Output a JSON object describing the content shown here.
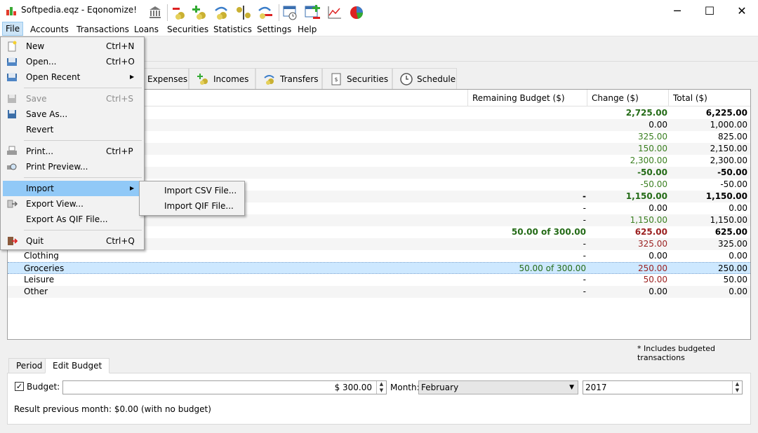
{
  "window": {
    "title": "Softpedia.eqz - Eqonomize!",
    "minimize": "─",
    "maximize": "☐",
    "close": "✕"
  },
  "menubar": {
    "items": [
      "File",
      "Accounts",
      "Transactions",
      "Loans",
      "Securities",
      "Statistics",
      "Settings",
      "Help"
    ]
  },
  "tabs": {
    "expenses": "Expenses",
    "incomes": "Incomes",
    "transfers": "Transfers",
    "securities": "Securities",
    "schedule": "Schedule"
  },
  "table": {
    "headers": {
      "remaining": "Remaining Budget ($)",
      "change": "Change ($)",
      "total": "Total ($)"
    },
    "rows": [
      {
        "name": "",
        "remaining": "",
        "change": "2,725.00",
        "total": "6,225.00",
        "style": "bold-green"
      },
      {
        "name": "",
        "remaining": "",
        "change": "0.00",
        "total": "1,000.00",
        "style": "plain"
      },
      {
        "name": "",
        "remaining": "",
        "change": "325.00",
        "total": "825.00",
        "style": "green"
      },
      {
        "name": "",
        "remaining": "",
        "change": "150.00",
        "total": "2,150.00",
        "style": "green"
      },
      {
        "name": "",
        "remaining": "",
        "change": "2,300.00",
        "total": "2,300.00",
        "style": "green"
      },
      {
        "name": "",
        "remaining": "",
        "change": "-50.00",
        "total": "-50.00",
        "style": "bold-green"
      },
      {
        "name": "",
        "remaining": "",
        "change": "-50.00",
        "total": "-50.00",
        "style": "green"
      },
      {
        "name": "",
        "remaining": "-",
        "change": "1,150.00",
        "total": "1,150.00",
        "style": "bold-green"
      },
      {
        "name": "",
        "remaining": "-",
        "change": "0.00",
        "total": "0.00",
        "style": "plain"
      },
      {
        "name": "",
        "remaining": "-",
        "change": "1,150.00",
        "total": "1,150.00",
        "style": "green"
      },
      {
        "name": "",
        "remaining": "50.00 of 300.00",
        "change": "625.00",
        "total": "625.00",
        "style": "bold-red"
      },
      {
        "name": "",
        "remaining": "-",
        "change": "325.00",
        "total": "325.00",
        "style": "red"
      },
      {
        "name": "Clothing",
        "remaining": "-",
        "change": "0.00",
        "total": "0.00",
        "style": "plain"
      },
      {
        "name": "Groceries",
        "remaining": "50.00 of 300.00",
        "change": "250.00",
        "total": "250.00",
        "style": "red-selected"
      },
      {
        "name": "Leisure",
        "remaining": "-",
        "change": "50.00",
        "total": "50.00",
        "style": "red"
      },
      {
        "name": "Other",
        "remaining": "-",
        "change": "0.00",
        "total": "0.00",
        "style": "plain"
      }
    ]
  },
  "file_menu": {
    "items": [
      {
        "label": "New",
        "shortcut": "Ctrl+N"
      },
      {
        "label": "Open...",
        "shortcut": "Ctrl+O"
      },
      {
        "label": "Open Recent",
        "shortcut": ""
      },
      {
        "label": "Save",
        "shortcut": "Ctrl+S"
      },
      {
        "label": "Save As...",
        "shortcut": ""
      },
      {
        "label": "Revert",
        "shortcut": ""
      },
      {
        "label": "Print...",
        "shortcut": "Ctrl+P"
      },
      {
        "label": "Print Preview...",
        "shortcut": ""
      },
      {
        "label": "Import",
        "shortcut": ""
      },
      {
        "label": "Export View...",
        "shortcut": ""
      },
      {
        "label": "Export As QIF File...",
        "shortcut": ""
      },
      {
        "label": "Quit",
        "shortcut": "Ctrl+Q"
      }
    ]
  },
  "import_submenu": {
    "items": [
      "Import CSV File...",
      "Import QIF File..."
    ]
  },
  "footnote": "* Includes budgeted transactions",
  "bottom_tabs": [
    "Period",
    "Edit Budget"
  ],
  "budget": {
    "checkbox_label": "Budget:",
    "amount": "$ 300.00",
    "month_label": "Month:",
    "month": "February",
    "year": "2017",
    "result": "Result previous month:  $0.00 (with no budget)"
  },
  "colors": {
    "green": "#3a7f20",
    "red": "#9b2121",
    "selection": "#cde8ff",
    "menu_highlight": "#91c9f7"
  }
}
